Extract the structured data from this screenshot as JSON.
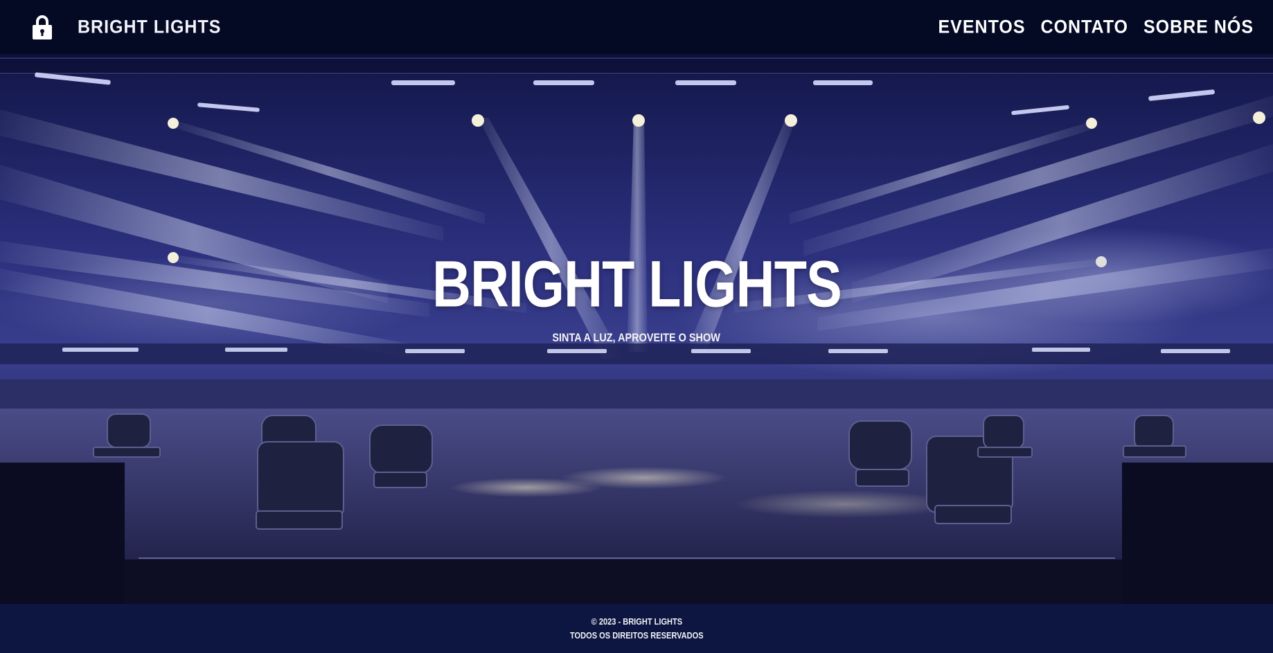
{
  "header": {
    "brand": "BRIGHT LIGHTS",
    "logo_icon": "lock-icon",
    "nav": [
      {
        "label": "EVENTOS"
      },
      {
        "label": "CONTATO"
      },
      {
        "label": "SOBRE NÓS"
      }
    ]
  },
  "hero": {
    "title": "BRIGHT LIGHTS",
    "subtitle": "SINTA A LUZ, APROVEITE O SHOW"
  },
  "footer": {
    "copyright": "© 2023 - BRIGHT LIGHTS",
    "rights": "TODOS OS DIREITOS RESERVADOS"
  },
  "colors": {
    "header_bg": "#040924",
    "footer_bg": "#0d1641",
    "stage_purple": "#3a3f8e",
    "beam": "#dfe6ff"
  }
}
